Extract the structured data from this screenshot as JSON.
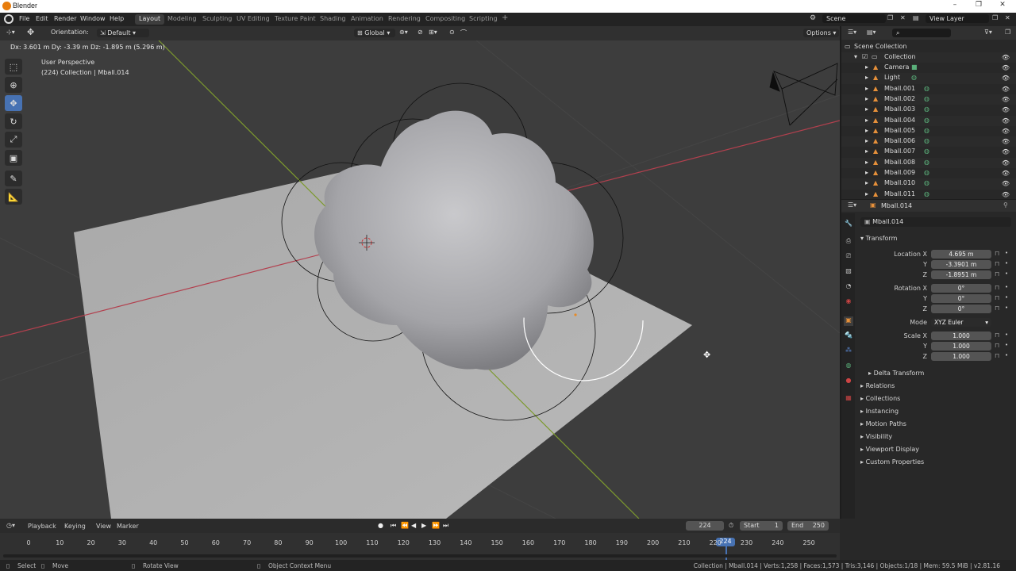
{
  "window": {
    "title": "Blender"
  },
  "menus": [
    "File",
    "Edit",
    "Render",
    "Window",
    "Help"
  ],
  "workspaces": [
    {
      "label": "Layout",
      "active": true
    },
    {
      "label": "Modeling"
    },
    {
      "label": "Sculpting"
    },
    {
      "label": "UV Editing"
    },
    {
      "label": "Texture Paint"
    },
    {
      "label": "Shading"
    },
    {
      "label": "Animation"
    },
    {
      "label": "Rendering"
    },
    {
      "label": "Compositing"
    },
    {
      "label": "Scripting"
    }
  ],
  "scene": "Scene",
  "view_layer": "View Layer",
  "viewport_header": {
    "orientation_label": "Orientation:",
    "orientation_value": "Default",
    "transform_orientation": "Global",
    "options": "Options"
  },
  "viewport": {
    "transform_readout": "Dx: 3.601 m  Dy: -3.39 m  Dz: -1.895 m (5.296 m)",
    "view_name": "User Perspective",
    "collection_info": "(224) Collection | Mball.014"
  },
  "outliner": {
    "root": "Scene Collection",
    "collection": "Collection",
    "items": [
      "Camera",
      "Light",
      "Mball.001",
      "Mball.002",
      "Mball.003",
      "Mball.004",
      "Mball.005",
      "Mball.006",
      "Mball.007",
      "Mball.008",
      "Mball.009",
      "Mball.010",
      "Mball.011"
    ]
  },
  "properties": {
    "object_name": "Mball.014",
    "object_field": "Mball.014",
    "transform_title": "Transform",
    "location": {
      "label": "Location X",
      "x": "4.695 m",
      "y": "-3.3901 m",
      "z": "-1.8951 m"
    },
    "rotation": {
      "label": "Rotation X",
      "x": "0°",
      "y": "0°",
      "z": "0°"
    },
    "mode": {
      "label": "Mode",
      "value": "XYZ Euler"
    },
    "scale": {
      "label": "Scale X",
      "x": "1.000",
      "y": "1.000",
      "z": "1.000"
    },
    "axis_y": "Y",
    "axis_z": "Z",
    "delta_transform": "Delta Transform",
    "sections": [
      "Relations",
      "Collections",
      "Instancing",
      "Motion Paths",
      "Visibility",
      "Viewport Display",
      "Custom Properties"
    ]
  },
  "timeline": {
    "menus": [
      "Playback",
      "Keying",
      "View",
      "Marker"
    ],
    "current_frame": "224",
    "start_label": "Start",
    "start": "1",
    "end_label": "End",
    "end": "250",
    "ticks": [
      "0",
      "10",
      "20",
      "30",
      "40",
      "50",
      "60",
      "70",
      "80",
      "90",
      "100",
      "110",
      "120",
      "130",
      "140",
      "150",
      "160",
      "170",
      "180",
      "190",
      "200",
      "210",
      "220",
      "230",
      "240",
      "250"
    ],
    "playhead": "224"
  },
  "statusbar": {
    "select": "Select",
    "move": "Move",
    "rotate_view": "Rotate View",
    "context_menu": "Object Context Menu",
    "stats": "Collection | Mball.014 | Verts:1,258 | Faces:1,573 | Tris:3,146 | Objects:1/18 | Mem: 59.5 MiB | v2.81.16"
  }
}
